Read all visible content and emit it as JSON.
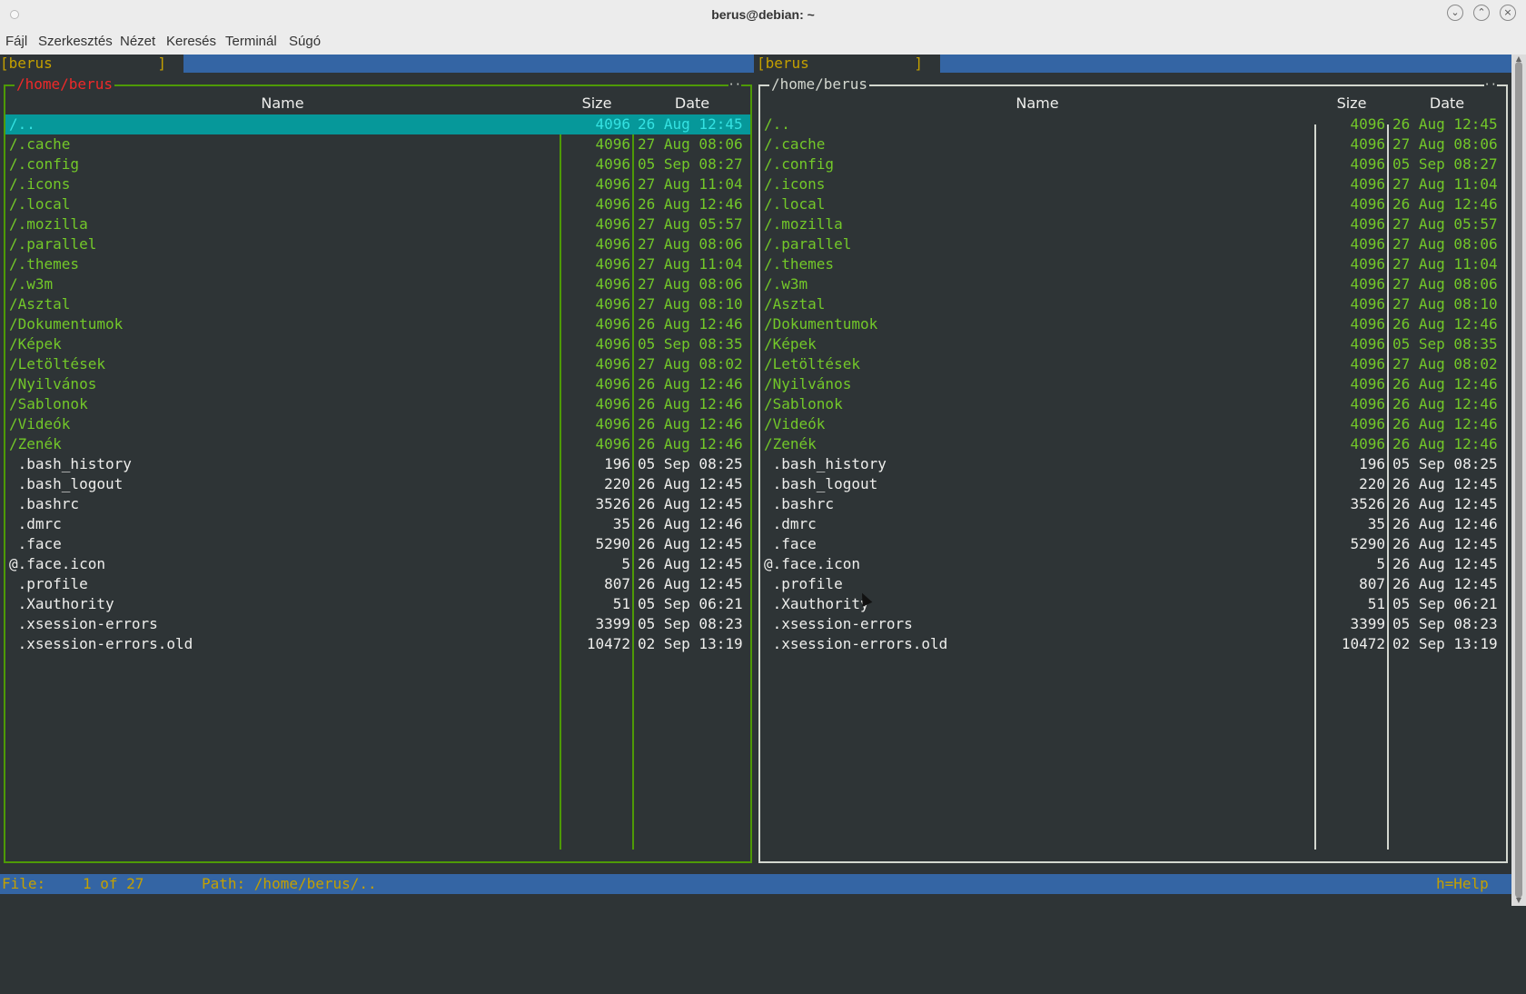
{
  "window": {
    "title": "berus@debian: ~"
  },
  "menu": [
    "Fájl",
    "Szerkesztés",
    "Nézet",
    "Keresés",
    "Terminál",
    "Súgó"
  ],
  "panels": [
    {
      "header_label": "[berus            ]",
      "path": "/home/berus",
      "columns": [
        "Name",
        "Size",
        "Date"
      ],
      "active": true,
      "selected_index": 0
    },
    {
      "header_label": "[berus            ]",
      "path": "/home/berus",
      "columns": [
        "Name",
        "Size",
        "Date"
      ],
      "active": false,
      "selected_index": -1
    }
  ],
  "files": [
    {
      "name": "/..",
      "size": "4096",
      "date": "26 Aug 12:45",
      "type": "dir"
    },
    {
      "name": "/.cache",
      "size": "4096",
      "date": "27 Aug 08:06",
      "type": "dir"
    },
    {
      "name": "/.config",
      "size": "4096",
      "date": "05 Sep 08:27",
      "type": "dir"
    },
    {
      "name": "/.icons",
      "size": "4096",
      "date": "27 Aug 11:04",
      "type": "dir"
    },
    {
      "name": "/.local",
      "size": "4096",
      "date": "26 Aug 12:46",
      "type": "dir"
    },
    {
      "name": "/.mozilla",
      "size": "4096",
      "date": "27 Aug 05:57",
      "type": "dir"
    },
    {
      "name": "/.parallel",
      "size": "4096",
      "date": "27 Aug 08:06",
      "type": "dir"
    },
    {
      "name": "/.themes",
      "size": "4096",
      "date": "27 Aug 11:04",
      "type": "dir"
    },
    {
      "name": "/.w3m",
      "size": "4096",
      "date": "27 Aug 08:06",
      "type": "dir"
    },
    {
      "name": "/Asztal",
      "size": "4096",
      "date": "27 Aug 08:10",
      "type": "dir"
    },
    {
      "name": "/Dokumentumok",
      "size": "4096",
      "date": "26 Aug 12:46",
      "type": "dir"
    },
    {
      "name": "/Képek",
      "size": "4096",
      "date": "05 Sep 08:35",
      "type": "dir"
    },
    {
      "name": "/Letöltések",
      "size": "4096",
      "date": "27 Aug 08:02",
      "type": "dir"
    },
    {
      "name": "/Nyilvános",
      "size": "4096",
      "date": "26 Aug 12:46",
      "type": "dir"
    },
    {
      "name": "/Sablonok",
      "size": "4096",
      "date": "26 Aug 12:46",
      "type": "dir"
    },
    {
      "name": "/Videók",
      "size": "4096",
      "date": "26 Aug 12:46",
      "type": "dir"
    },
    {
      "name": "/Zenék",
      "size": "4096",
      "date": "26 Aug 12:46",
      "type": "dir"
    },
    {
      "name": " .bash_history",
      "size": "196",
      "date": "05 Sep 08:25",
      "type": "file"
    },
    {
      "name": " .bash_logout",
      "size": "220",
      "date": "26 Aug 12:45",
      "type": "file"
    },
    {
      "name": " .bashrc",
      "size": "3526",
      "date": "26 Aug 12:45",
      "type": "file"
    },
    {
      "name": " .dmrc",
      "size": "35",
      "date": "26 Aug 12:46",
      "type": "file"
    },
    {
      "name": " .face",
      "size": "5290",
      "date": "26 Aug 12:45",
      "type": "file"
    },
    {
      "name": "@.face.icon",
      "size": "5",
      "date": "26 Aug 12:45",
      "type": "file"
    },
    {
      "name": " .profile",
      "size": "807",
      "date": "26 Aug 12:45",
      "type": "file"
    },
    {
      "name": " .Xauthority",
      "size": "51",
      "date": "05 Sep 06:21",
      "type": "file"
    },
    {
      "name": " .xsession-errors",
      "size": "3399",
      "date": "05 Sep 08:23",
      "type": "file"
    },
    {
      "name": " .xsession-errors.old",
      "size": "10472",
      "date": "02 Sep 13:19",
      "type": "file"
    }
  ],
  "status": {
    "file_label": "File:",
    "file_count": "1 of 27",
    "path_label": "Path: /home/berus/..",
    "help": "h=Help"
  }
}
